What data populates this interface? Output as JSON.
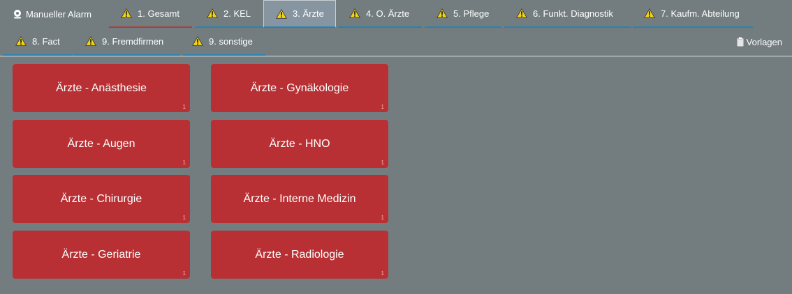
{
  "tabs_row1": [
    {
      "label": "Manueller Alarm",
      "icon": "map-pin-icon"
    },
    {
      "label": "1. Gesamt",
      "icon": "warning-icon"
    },
    {
      "label": "2. KEL",
      "icon": "warning-icon"
    },
    {
      "label": "3. Ärzte",
      "icon": "warning-icon",
      "active": true
    },
    {
      "label": "4. O. Ärzte",
      "icon": "warning-icon"
    },
    {
      "label": "5. Pflege",
      "icon": "warning-icon"
    },
    {
      "label": "6. Funkt. Diagnostik",
      "icon": "warning-icon"
    },
    {
      "label": "7. Kaufm. Abteilung",
      "icon": "warning-icon"
    }
  ],
  "tabs_row2": [
    {
      "label": "8. Fact",
      "icon": "warning-icon"
    },
    {
      "label": "9. Fremdfirmen",
      "icon": "warning-icon"
    },
    {
      "label": "9. sonstige",
      "icon": "warning-icon"
    }
  ],
  "vorlagen": {
    "label": "Vorlagen",
    "icon": "clipboard-icon"
  },
  "alarms": [
    {
      "label": "Ärzte - Anästhesie",
      "count": "1"
    },
    {
      "label": "Ärzte - Gynäkologie",
      "count": "1"
    },
    {
      "label": "Ärzte - Augen",
      "count": "1"
    },
    {
      "label": "Ärzte - HNO",
      "count": "1"
    },
    {
      "label": "Ärzte - Chirurgie",
      "count": "1"
    },
    {
      "label": "Ärzte - Interne Medizin",
      "count": "1"
    },
    {
      "label": "Ärzte - Geriatrie",
      "count": "1"
    },
    {
      "label": "Ärzte - Radiologie",
      "count": "1"
    }
  ],
  "colors": {
    "background": "#737d80",
    "alarm_button": "#b83034",
    "tab_underline": "#1c86c0",
    "tab_underline_alert": "#b33a3d",
    "warning_icon": "#f2d416"
  }
}
